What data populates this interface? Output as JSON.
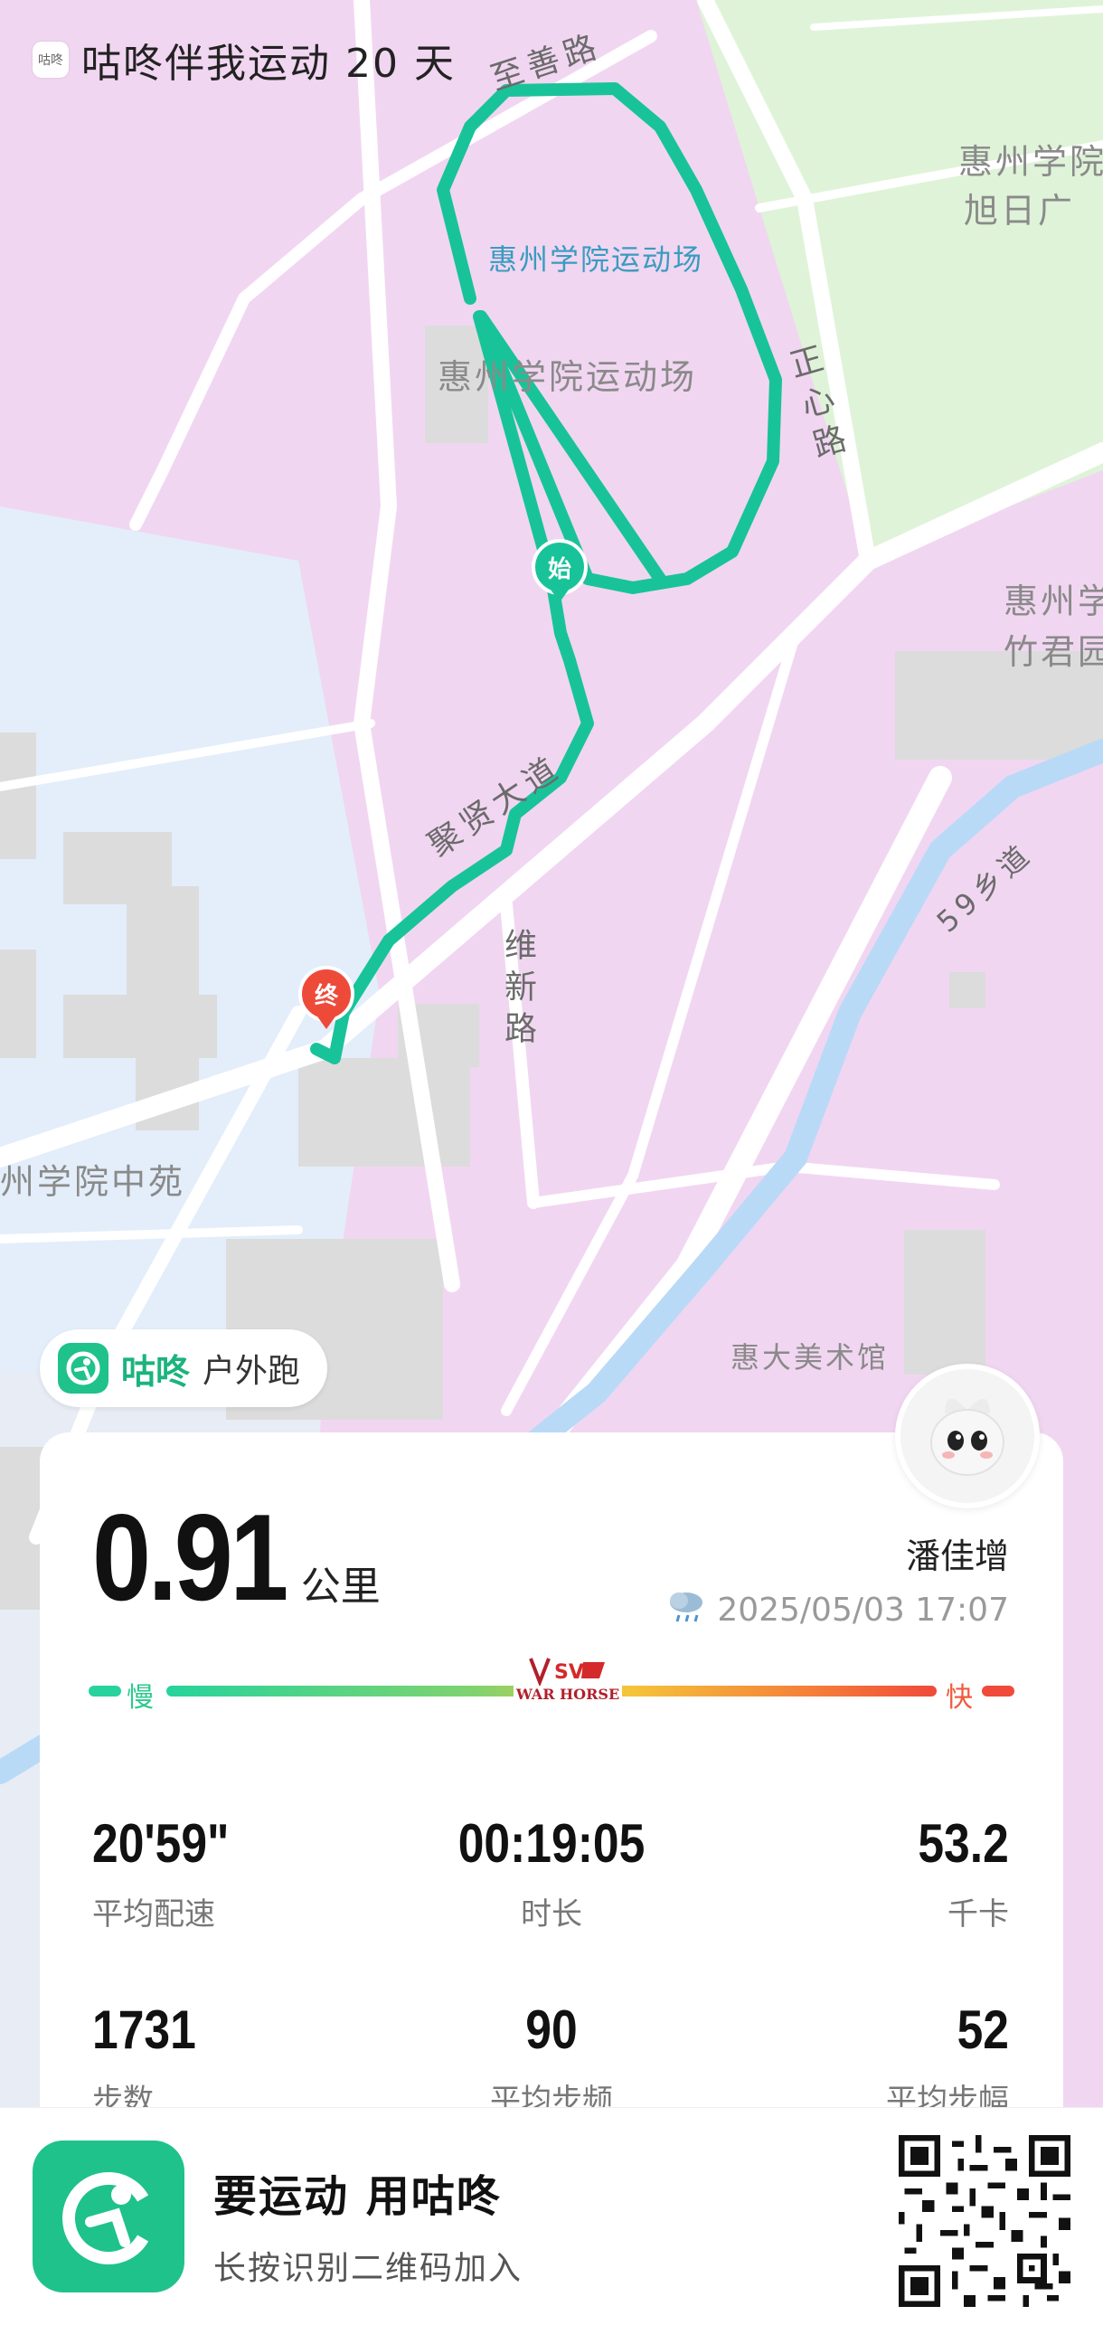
{
  "header": {
    "logo_text": "咕咚",
    "text": "咕咚伴我运动 20 天"
  },
  "map": {
    "roads": [
      {
        "label": "至善路"
      },
      {
        "label": "正心路"
      },
      {
        "label": "聚贤大道"
      },
      {
        "label": "维新路"
      },
      {
        "label": "59乡道"
      }
    ],
    "pois": [
      {
        "label": "惠州学院运动场",
        "style": "blue"
      },
      {
        "label": "惠州学院运动场",
        "style": "gray"
      },
      {
        "label": "惠州学院",
        "style": "gray"
      },
      {
        "label": "旭日广",
        "style": "gray"
      },
      {
        "label": "惠州学",
        "style": "gray"
      },
      {
        "label": "竹君园",
        "style": "gray"
      },
      {
        "label": "州学院中苑",
        "style": "gray"
      },
      {
        "label": "惠大美术馆",
        "style": "gray"
      }
    ],
    "start_marker": "始",
    "end_marker": "终",
    "route_color": "#19c39a"
  },
  "activity": {
    "brand": "咕咚",
    "type": "户外跑"
  },
  "summary": {
    "distance": "0.91",
    "distance_unit": "公里",
    "user": "潘佳增",
    "weather_icon": "rain-cloud-icon",
    "datetime": "2025/05/03 17:07",
    "pace_slow": "慢",
    "pace_fast": "快",
    "sponsor": "WAR HORSE"
  },
  "stats": [
    {
      "value": "20'59\"",
      "label": "平均配速"
    },
    {
      "value": "00:19:05",
      "label": "时长"
    },
    {
      "value": "53.2",
      "label": "千卡"
    },
    {
      "value": "1731",
      "label": "步数"
    },
    {
      "value": "90",
      "label": "平均步频"
    },
    {
      "value": "52",
      "label": "平均步幅"
    }
  ],
  "footer": {
    "slogan": "要运动 用咕咚",
    "hint": "长按识别二维码加入"
  },
  "colors": {
    "brand": "#1fc28a",
    "map_bg": "#f1d6f1",
    "start": "#19c39a",
    "end": "#ee4a3a"
  }
}
